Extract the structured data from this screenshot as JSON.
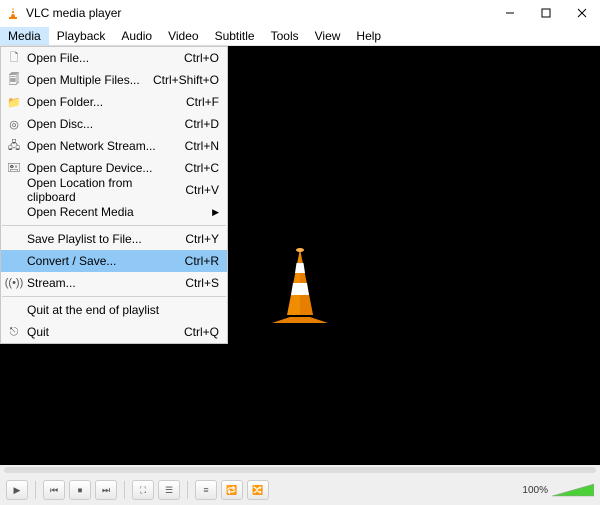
{
  "title": "VLC media player",
  "menubar": [
    "Media",
    "Playback",
    "Audio",
    "Video",
    "Subtitle",
    "Tools",
    "View",
    "Help"
  ],
  "activeMenuIndex": 0,
  "dropdown": {
    "groups": [
      [
        {
          "icon": "file",
          "label": "Open File...",
          "shortcut": "Ctrl+O"
        },
        {
          "icon": "files",
          "label": "Open Multiple Files...",
          "shortcut": "Ctrl+Shift+O"
        },
        {
          "icon": "folder",
          "label": "Open Folder...",
          "shortcut": "Ctrl+F"
        },
        {
          "icon": "disc",
          "label": "Open Disc...",
          "shortcut": "Ctrl+D"
        },
        {
          "icon": "network",
          "label": "Open Network Stream...",
          "shortcut": "Ctrl+N"
        },
        {
          "icon": "capture",
          "label": "Open Capture Device...",
          "shortcut": "Ctrl+C"
        },
        {
          "icon": "",
          "label": "Open Location from clipboard",
          "shortcut": "Ctrl+V"
        },
        {
          "icon": "",
          "label": "Open Recent Media",
          "submenu": true
        }
      ],
      [
        {
          "icon": "",
          "label": "Save Playlist to File...",
          "shortcut": "Ctrl+Y"
        },
        {
          "icon": "",
          "label": "Convert / Save...",
          "shortcut": "Ctrl+R",
          "highlight": true
        },
        {
          "icon": "stream",
          "label": "Stream...",
          "shortcut": "Ctrl+S"
        }
      ],
      [
        {
          "icon": "",
          "label": "Quit at the end of playlist"
        },
        {
          "icon": "quit",
          "label": "Quit",
          "shortcut": "Ctrl+Q"
        }
      ]
    ]
  },
  "volume": "100%",
  "icons": {
    "file": "🗋",
    "files": "🗐",
    "folder": "📁",
    "disc": "◎",
    "network": "🖧",
    "capture": "🖭",
    "stream": "((•))",
    "quit": "⎋"
  }
}
